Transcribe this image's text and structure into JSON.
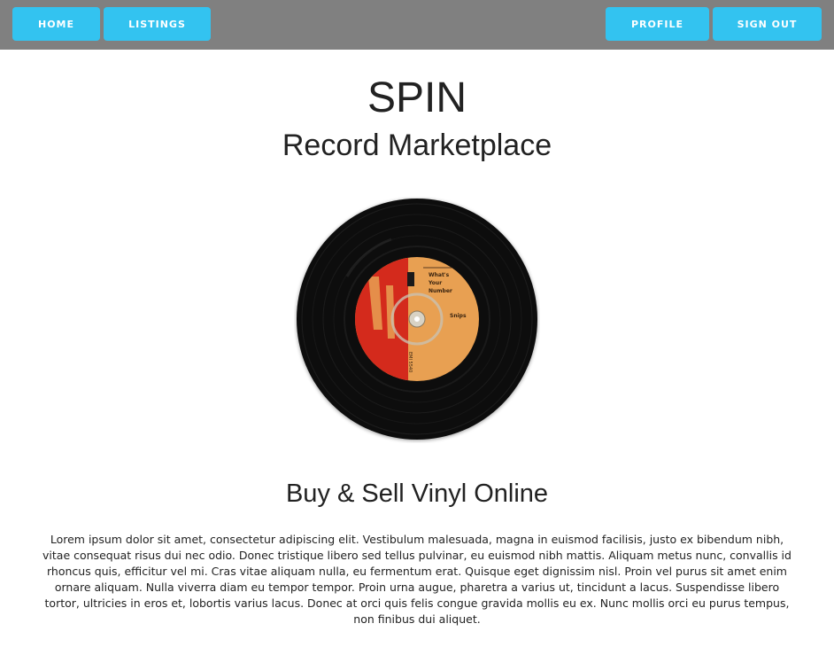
{
  "nav": {
    "home_label": "HOME",
    "listings_label": "LISTINGS",
    "profile_label": "PROFILE",
    "signout_label": "SIGN OUT"
  },
  "hero": {
    "title": "SPIN",
    "subtitle": "Record Marketplace"
  },
  "record_image": {
    "label_title": "What's Your Number",
    "label_artist": "Snips",
    "label_brand": "EMI",
    "label_catalog": "EMI 5540"
  },
  "section": {
    "headline": "Buy & Sell Vinyl Online",
    "body": "Lorem ipsum dolor sit amet, consectetur adipiscing elit. Vestibulum malesuada, magna in euismod facilisis, justo ex bibendum nibh, vitae consequat risus dui nec odio. Donec tristique libero sed tellus pulvinar, eu euismod nibh mattis. Aliquam metus nunc, convallis id rhoncus quis, efficitur vel mi. Cras vitae aliquam nulla, eu fermentum erat. Quisque eget dignissim nisl. Proin vel purus sit amet enim ornare aliquam. Nulla viverra diam eu tempor tempor. Proin urna augue, pharetra a varius ut, tincidunt a lacus. Suspendisse libero tortor, ultricies in eros et, lobortis varius lacus. Donec at orci quis felis congue gravida mollis eu ex. Nunc mollis orci eu purus tempus, non finibus dui aliquet."
  },
  "colors": {
    "topbar": "#808080",
    "button": "#33c3f0",
    "label_red": "#d42a1c",
    "label_orange": "#e8a052"
  }
}
